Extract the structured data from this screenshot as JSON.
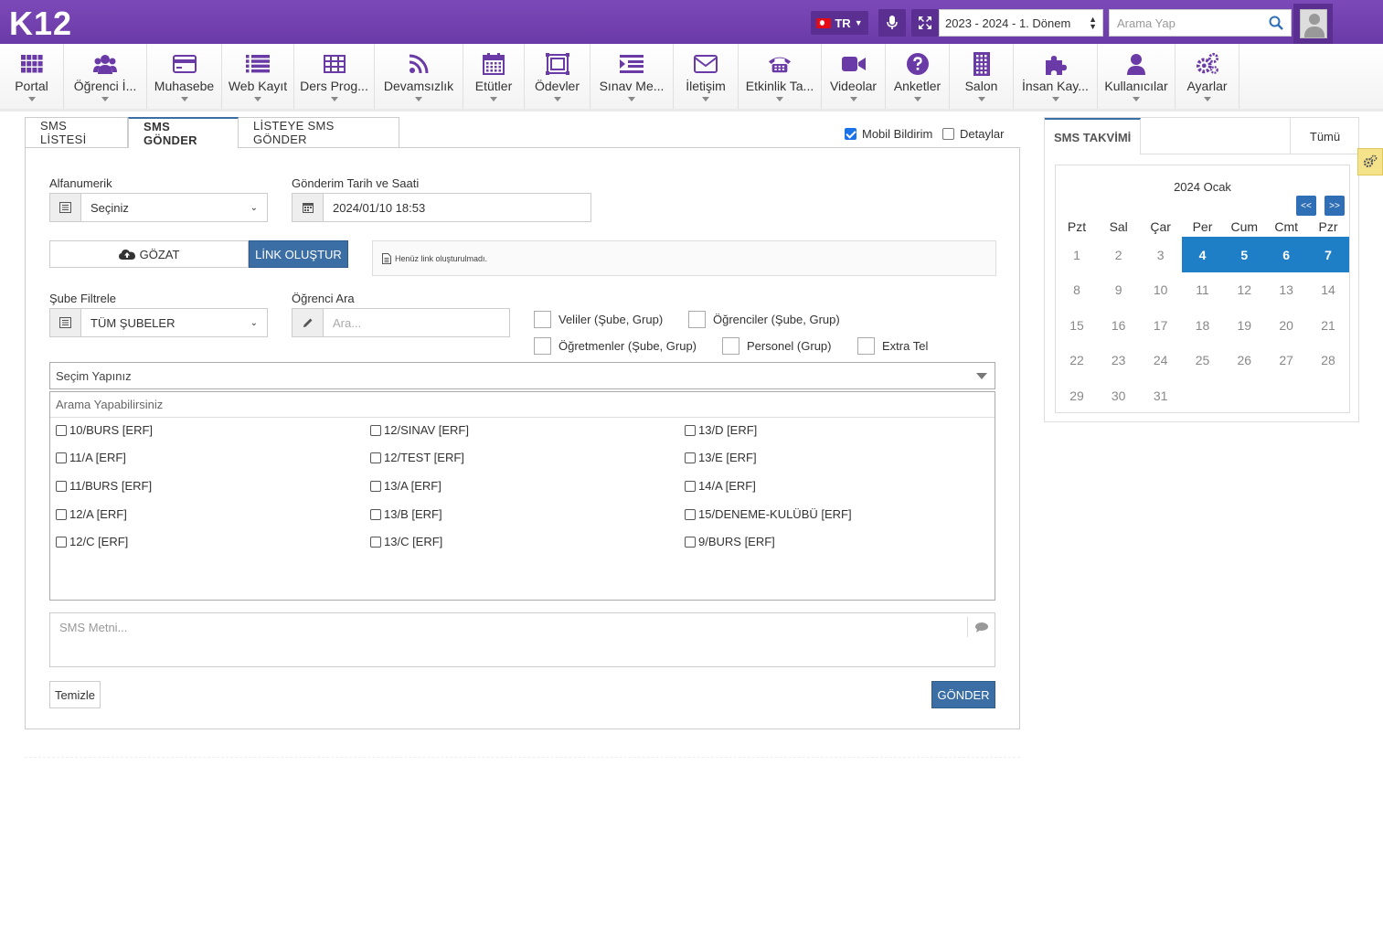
{
  "app": {
    "logo": "K12"
  },
  "topbar": {
    "lang": "TR",
    "term": "2023 - 2024 - 1. Dönem",
    "search_placeholder": "Arama Yap"
  },
  "menu": [
    {
      "label": "Portal",
      "icon": "grid-icon"
    },
    {
      "label": "Öğrenci İ...",
      "icon": "users-icon"
    },
    {
      "label": "Muhasebe",
      "icon": "credit-card-icon"
    },
    {
      "label": "Web Kayıt",
      "icon": "list-icon"
    },
    {
      "label": "Ders Prog...",
      "icon": "table-icon"
    },
    {
      "label": "Devamsızlık",
      "icon": "rss-icon"
    },
    {
      "label": "Etütler",
      "icon": "calendar-icon"
    },
    {
      "label": "Ödevler",
      "icon": "image-frame-icon"
    },
    {
      "label": "Sınav Me...",
      "icon": "indent-list-icon"
    },
    {
      "label": "İletişim",
      "icon": "envelope-icon"
    },
    {
      "label": "Etkinlik Ta...",
      "icon": "phone-icon"
    },
    {
      "label": "Videolar",
      "icon": "video-icon"
    },
    {
      "label": "Anketler",
      "icon": "question-icon"
    },
    {
      "label": "Salon",
      "icon": "building-icon"
    },
    {
      "label": "İnsan Kay...",
      "icon": "puzzle-icon"
    },
    {
      "label": "Kullanıcılar",
      "icon": "user-icon"
    },
    {
      "label": "Ayarlar",
      "icon": "gears-icon"
    }
  ],
  "tabs": [
    "SMS LİSTESİ",
    "SMS GÖNDER",
    "LİSTEYE SMS GÖNDER"
  ],
  "top_checks": {
    "mobil": "Mobil Bildirim",
    "detaylar": "Detaylar"
  },
  "form": {
    "alfanumerik_label": "Alfanumerik",
    "alfanumerik_value": "Seçiniz",
    "tarih_label": "Gönderim Tarih ve Saati",
    "tarih_value": "2024/01/10 18:53",
    "gozat": "GÖZAT",
    "link_olustur": "LİNK OLUŞTUR",
    "link_info": "Henüz link oluşturulmadı.",
    "sube_label": "Şube Filtrele",
    "sube_value": "TÜM ŞUBELER",
    "ogrenci_label": "Öğrenci Ara",
    "ogrenci_placeholder": "Ara...",
    "options": {
      "veliler": "Veliler (Şube, Grup)",
      "ogrenciler": "Öğrenciler (Şube, Grup)",
      "ogretmenler": "Öğretmenler (Şube, Grup)",
      "personel": "Personel (Grup)",
      "extra_tel": "Extra Tel"
    },
    "secim": "Seçim Yapınız",
    "list_search": "Arama Yapabilirsiniz",
    "groups": [
      [
        "10/BURS [ERF]",
        "11/A [ERF]",
        "11/BURS [ERF]",
        "12/A [ERF]",
        "12/C [ERF]"
      ],
      [
        "12/SINAV [ERF]",
        "12/TEST [ERF]",
        "13/A [ERF]",
        "13/B [ERF]",
        "13/C [ERF]"
      ],
      [
        "13/D [ERF]",
        "13/E [ERF]",
        "14/A [ERF]",
        "15/DENEME-KULÜBÜ [ERF]",
        "9/BURS [ERF]"
      ]
    ],
    "sms_placeholder": "SMS Metni...",
    "temizle": "Temizle",
    "gonder": "GÖNDER"
  },
  "calendar": {
    "tab": "SMS TAKVİMİ",
    "tumu": "Tümü",
    "title": "2024 Ocak",
    "prev": "<<",
    "next": ">>",
    "dow": [
      "Pzt",
      "Sal",
      "Çar",
      "Per",
      "Cum",
      "Cmt",
      "Pzr"
    ],
    "weeks": [
      [
        "1",
        "2",
        "3",
        "4",
        "5",
        "6",
        "7"
      ],
      [
        "8",
        "9",
        "10",
        "11",
        "12",
        "13",
        "14"
      ],
      [
        "15",
        "16",
        "17",
        "18",
        "19",
        "20",
        "21"
      ],
      [
        "22",
        "23",
        "24",
        "25",
        "26",
        "27",
        "28"
      ],
      [
        "29",
        "30",
        "31",
        "",
        "",
        "",
        ""
      ]
    ],
    "highlighted": [
      "4",
      "5",
      "6",
      "7"
    ],
    "highlight_color": "#1f7fc6"
  },
  "colors": {
    "brand": "#6a3aa7",
    "primary": "#3a6ea5"
  }
}
